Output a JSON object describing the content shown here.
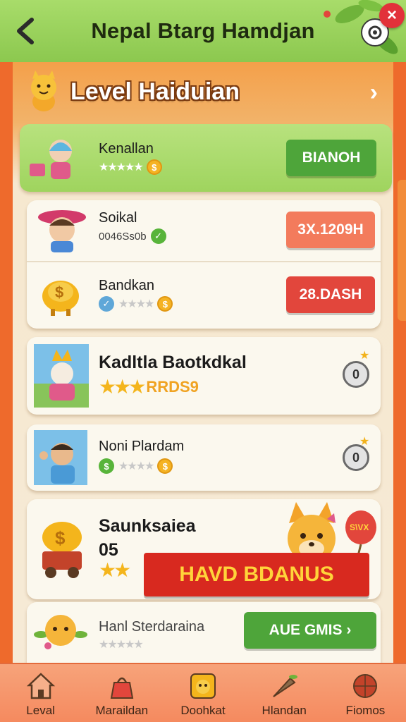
{
  "header": {
    "title": "Nepal Btarg Hamdjan",
    "back_icon": "chevron-left-icon",
    "settings_icon": "gear-icon",
    "close_icon": "close-icon",
    "close_glyph": "×"
  },
  "level_header": {
    "title": "Level Haiduian",
    "chevron": "›"
  },
  "items": [
    {
      "name": "Kenallan",
      "button": "BIANOH",
      "button_color": "#4ea53a",
      "stars": "★★★★★",
      "coin": "$"
    },
    {
      "name": "Soikal",
      "meta": "0046Ss0b",
      "button": "3X.1209H",
      "button_color": "#f37b5c",
      "check": "✓"
    },
    {
      "name": "Bandkan",
      "button": "28.DASH",
      "button_color": "#e2463c",
      "stars": "★★★★",
      "coin": "$",
      "check": "✓"
    },
    {
      "name": "Kadltla Baotkdkal",
      "stars": "★★★",
      "meta": "RRDS9",
      "round_label": "0"
    },
    {
      "name": "Noni Plardam",
      "stars": "★★★★",
      "coin_left": "$",
      "coin": "$",
      "round_label": "0"
    },
    {
      "name": "Saunksaiea",
      "sub": "05",
      "stars": "★★",
      "banner": "HAVD BDANUS",
      "balloon": "S\\VX"
    },
    {
      "name": "Hanl Sterdaraina",
      "stars": "★★★★★",
      "button": "AUE GMIS ›",
      "button_color": "#4ea53a"
    }
  ],
  "bottom_nav": [
    {
      "label": "Leval",
      "icon": "house-icon"
    },
    {
      "label": "Maraildan",
      "icon": "bag-icon"
    },
    {
      "label": "Doohkat",
      "icon": "mascot-icon"
    },
    {
      "label": "Hlandan",
      "icon": "carrot-icon"
    },
    {
      "label": "Fiomos",
      "icon": "ball-icon"
    }
  ],
  "colors": {
    "background": "#ee6a2c",
    "topbar": "#8cc84f",
    "green_button": "#4ea53a",
    "red_button": "#e2463c",
    "salmon_button": "#f37b5c",
    "gold": "#f4b51c",
    "banner": "#d8291f"
  }
}
